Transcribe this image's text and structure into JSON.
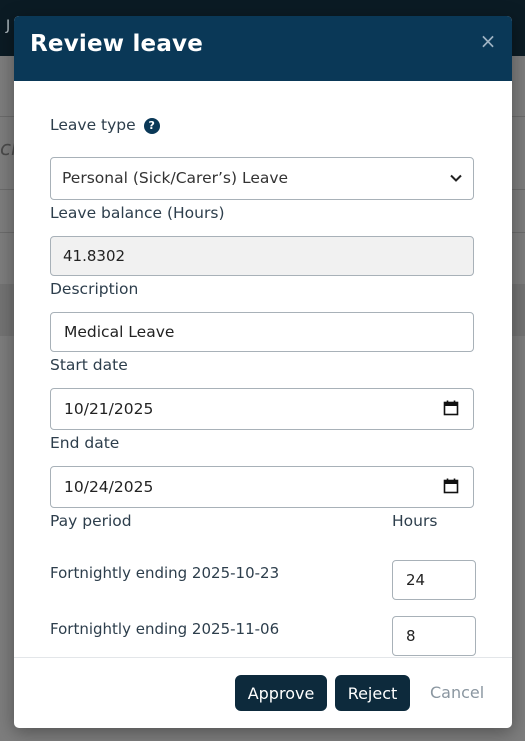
{
  "background": {
    "topbar_text": "J",
    "left_text": "ch"
  },
  "modal": {
    "title": "Review leave",
    "close_glyph": "×",
    "leave_type": {
      "label": "Leave type",
      "help_glyph": "?",
      "value": "Personal (Sick/Carer’s) Leave"
    },
    "leave_balance": {
      "label": "Leave balance (Hours)",
      "value": "41.8302"
    },
    "description": {
      "label": "Description",
      "value": "Medical Leave"
    },
    "start_date": {
      "label": "Start date",
      "value": "10/21/2025"
    },
    "end_date": {
      "label": "End date",
      "value": "10/24/2025"
    },
    "pay_table": {
      "col_period": "Pay period",
      "col_hours": "Hours",
      "rows": [
        {
          "period": "Fortnightly ending 2025-10-23",
          "hours": "24"
        },
        {
          "period": "Fortnightly ending 2025-11-06",
          "hours": "8"
        }
      ]
    },
    "actions": {
      "approve": "Approve",
      "reject": "Reject",
      "cancel": "Cancel"
    }
  },
  "colors": {
    "header": "#0a3857",
    "button": "#0d2a3c",
    "overlay": "#7d7d7d"
  }
}
